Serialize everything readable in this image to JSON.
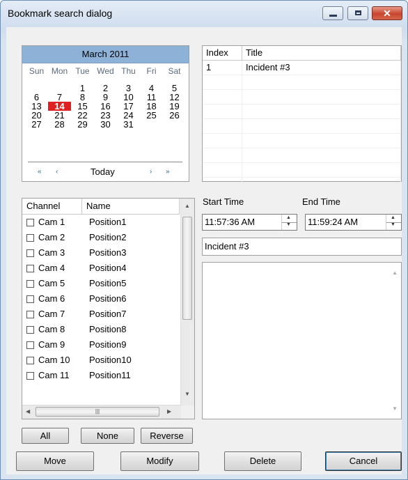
{
  "window": {
    "title": "Bookmark search dialog",
    "controls": {
      "minimize": "minimize-icon",
      "maximize": "maximize-icon",
      "close": "close-icon"
    }
  },
  "calendar": {
    "month": "March 2011",
    "weekdays": [
      "Sun",
      "Mon",
      "Tue",
      "Wed",
      "Thu",
      "Fri",
      "Sat"
    ],
    "weeks": [
      [
        "",
        "",
        "1",
        "2",
        "3",
        "4",
        "5"
      ],
      [
        "6",
        "7",
        "8",
        "9",
        "10",
        "11",
        "12"
      ],
      [
        "13",
        "14",
        "15",
        "16",
        "17",
        "18",
        "19"
      ],
      [
        "20",
        "21",
        "22",
        "23",
        "24",
        "25",
        "26"
      ],
      [
        "27",
        "28",
        "29",
        "30",
        "31",
        "",
        ""
      ]
    ],
    "selected_day": "14",
    "today_label": "Today",
    "nav": {
      "prev_year": "«",
      "prev_month": "‹",
      "next_month": "›",
      "next_year": "»"
    }
  },
  "bookmarks": {
    "columns": [
      "Index",
      "Title"
    ],
    "rows": [
      {
        "index": "1",
        "title": "Incident #3"
      }
    ]
  },
  "channels": {
    "columns": [
      "Channel",
      "Name"
    ],
    "rows": [
      {
        "channel": "Cam 1",
        "name": "Position1"
      },
      {
        "channel": "Cam 2",
        "name": "Position2"
      },
      {
        "channel": "Cam 3",
        "name": "Position3"
      },
      {
        "channel": "Cam 4",
        "name": "Position4"
      },
      {
        "channel": "Cam 5",
        "name": "Position5"
      },
      {
        "channel": "Cam 6",
        "name": "Position6"
      },
      {
        "channel": "Cam 7",
        "name": "Position7"
      },
      {
        "channel": "Cam 8",
        "name": "Position8"
      },
      {
        "channel": "Cam 9",
        "name": "Position9"
      },
      {
        "channel": "Cam 10",
        "name": "Position10"
      },
      {
        "channel": "Cam 11",
        "name": "Position11"
      }
    ]
  },
  "details": {
    "start_time_label": "Start Time",
    "end_time_label": "End Time",
    "start_time": "11:57:36 AM",
    "end_time": "11:59:24 AM",
    "title_value": "Incident #3",
    "description": ""
  },
  "buttons": {
    "all": "All",
    "none": "None",
    "reverse": "Reverse",
    "move": "Move",
    "modify": "Modify",
    "delete": "Delete",
    "cancel": "Cancel"
  }
}
